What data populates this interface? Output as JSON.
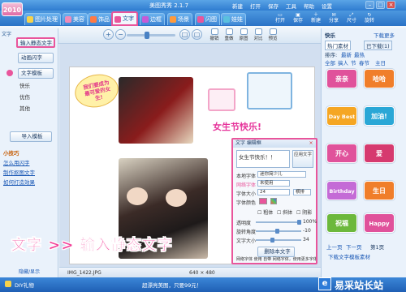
{
  "app": {
    "title": "美图秀秀 2.1.7",
    "logo_text": "2010",
    "menu": [
      "新建",
      "打开",
      "保存",
      "工具",
      "帮助",
      "设置"
    ]
  },
  "tabs": [
    {
      "label": "图片处理"
    },
    {
      "label": "美容"
    },
    {
      "label": "饰品"
    },
    {
      "label": "文字"
    },
    {
      "label": "边框"
    },
    {
      "label": "场景"
    },
    {
      "label": "闪图"
    },
    {
      "label": "娃娃"
    }
  ],
  "toolbar_icons": [
    {
      "label": "打开"
    },
    {
      "label": "保存"
    },
    {
      "label": "新建"
    },
    {
      "label": "分享"
    },
    {
      "label": "尺寸"
    },
    {
      "label": "旋转"
    }
  ],
  "subtools": [
    {
      "label": "撤销"
    },
    {
      "label": "重做"
    },
    {
      "label": "原图"
    },
    {
      "label": "对比"
    },
    {
      "label": "预览"
    }
  ],
  "left": {
    "top_tab": "文字",
    "buttons": [
      {
        "label": "输入静态文字"
      },
      {
        "label": "动画闪字"
      },
      {
        "label": "文字模板"
      }
    ],
    "categories": [
      "快乐",
      "优伤",
      "其他"
    ],
    "import_label": "导入模板",
    "tips": {
      "title": "小技巧",
      "links": [
        "怎么用闪字",
        "制作抠图文字",
        "如何打造效果"
      ]
    },
    "toggle_label": "隐藏/显示"
  },
  "canvas": {
    "bubble_text": "我们要成为最可爱的女生!",
    "holiday_text": "女生节快乐!",
    "caption": "文字 >> 输入静态文字"
  },
  "editor": {
    "title": "文字 编辑框",
    "text_value": "女生节快乐！！",
    "apply_label": "应用文字",
    "local_font_label": "本地字体",
    "local_font_value": "迷你简少儿",
    "net_font_label": "网络字体",
    "net_font_value": "未使用",
    "size_label": "字体大小",
    "size_value": "24",
    "orient_value": "横排",
    "color_label": "字体颜色",
    "style_bold": "粗体",
    "style_italic": "斜体",
    "style_shadow": "阴影",
    "opacity_label": "透明度",
    "opacity_value": "100%",
    "rotate_label": "旋转角度",
    "rotate_value": "-10",
    "spacing_label": "文字大小",
    "spacing_value": "34",
    "delete_label": "删除本文字",
    "footer": "网络字体 使用 自带 网络字体，使用更多字体"
  },
  "status": {
    "filename": "IMG_1422.JPG",
    "dims": "640 × 480"
  },
  "bottom": {
    "left": "DIY礼物",
    "center": "超漂亮美图，只要99元！",
    "watermark": "易采站长站"
  },
  "right": {
    "tab_label": "快乐",
    "download_more": "下载更多",
    "hot_label": "热门素材",
    "download_label": "已下载(1)",
    "sort_label": "排序:",
    "filters": [
      "最新",
      "最热"
    ],
    "sub_filters": [
      "全部",
      "搞人",
      "节",
      "春节",
      "主日"
    ],
    "stickers": [
      {
        "text": "亲亲",
        "color": "#e0529b"
      },
      {
        "text": "哈哈",
        "color": "#f07e2a"
      },
      {
        "text": "Day Best",
        "color": "#f5a623"
      },
      {
        "text": "加油!",
        "color": "#2aa7d6"
      },
      {
        "text": "开心",
        "color": "#e0529b"
      },
      {
        "text": "爱",
        "color": "#d63a6f"
      },
      {
        "text": "Birthday",
        "color": "#c46bd6"
      },
      {
        "text": "生日",
        "color": "#f07e2a"
      },
      {
        "text": "祝福",
        "color": "#6cb83c"
      },
      {
        "text": "Happy",
        "color": "#e0529b"
      }
    ],
    "page_prev": "上一页",
    "page_next": "下一页",
    "page_num": "第1页",
    "download_hint": "下载文字模板素材"
  }
}
